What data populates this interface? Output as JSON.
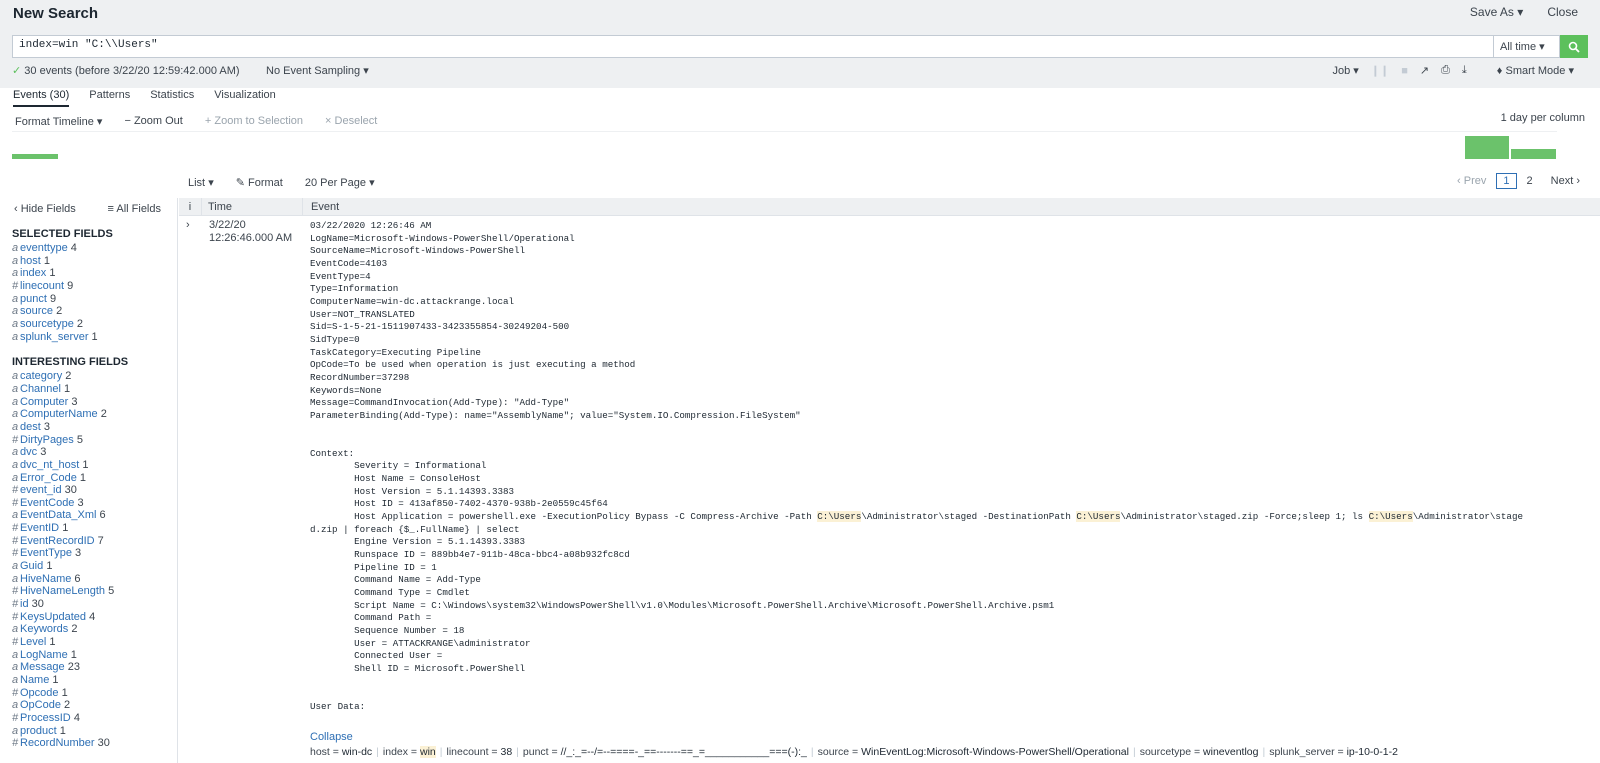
{
  "header": {
    "title": "New Search",
    "save_as": "Save As",
    "close": "Close"
  },
  "search": {
    "query": "index=win \"C:\\\\Users\"",
    "time_range": "All time"
  },
  "status": {
    "summary": "30 events (before 3/22/20 12:59:42.000 AM)",
    "sampling": "No Event Sampling",
    "job": "Job",
    "mode": "Smart Mode"
  },
  "tabs": [
    "Events (30)",
    "Patterns",
    "Statistics",
    "Visualization"
  ],
  "timeline": {
    "format": "Format Timeline",
    "zoom_out": "Zoom Out",
    "zoom_selection": "Zoom to Selection",
    "deselect": "Deselect",
    "scale": "1 day per column",
    "bars": [
      {
        "level": 0.18
      },
      {
        "level": 0.82
      },
      {
        "level": 0.36
      }
    ]
  },
  "list_controls": {
    "list": "List",
    "format": "Format",
    "per_page": "20 Per Page"
  },
  "pager": {
    "prev": "Prev",
    "pages": [
      "1",
      "2"
    ],
    "next": "Next"
  },
  "sidebar": {
    "hide_fields": "Hide Fields",
    "all_fields": "All Fields",
    "selected_heading": "SELECTED FIELDS",
    "interesting_heading": "INTERESTING FIELDS",
    "selected": [
      {
        "type": "a",
        "name": "eventtype",
        "count": "4"
      },
      {
        "type": "a",
        "name": "host",
        "count": "1"
      },
      {
        "type": "a",
        "name": "index",
        "count": "1"
      },
      {
        "type": "#",
        "name": "linecount",
        "count": "9"
      },
      {
        "type": "a",
        "name": "punct",
        "count": "9"
      },
      {
        "type": "a",
        "name": "source",
        "count": "2"
      },
      {
        "type": "a",
        "name": "sourcetype",
        "count": "2"
      },
      {
        "type": "a",
        "name": "splunk_server",
        "count": "1"
      }
    ],
    "interesting": [
      {
        "type": "a",
        "name": "category",
        "count": "2"
      },
      {
        "type": "a",
        "name": "Channel",
        "count": "1"
      },
      {
        "type": "a",
        "name": "Computer",
        "count": "3"
      },
      {
        "type": "a",
        "name": "ComputerName",
        "count": "2"
      },
      {
        "type": "a",
        "name": "dest",
        "count": "3"
      },
      {
        "type": "#",
        "name": "DirtyPages",
        "count": "5"
      },
      {
        "type": "a",
        "name": "dvc",
        "count": "3"
      },
      {
        "type": "a",
        "name": "dvc_nt_host",
        "count": "1"
      },
      {
        "type": "a",
        "name": "Error_Code",
        "count": "1"
      },
      {
        "type": "#",
        "name": "event_id",
        "count": "30"
      },
      {
        "type": "#",
        "name": "EventCode",
        "count": "3"
      },
      {
        "type": "a",
        "name": "EventData_Xml",
        "count": "6"
      },
      {
        "type": "#",
        "name": "EventID",
        "count": "1"
      },
      {
        "type": "#",
        "name": "EventRecordID",
        "count": "7"
      },
      {
        "type": "#",
        "name": "EventType",
        "count": "3"
      },
      {
        "type": "a",
        "name": "Guid",
        "count": "1"
      },
      {
        "type": "a",
        "name": "HiveName",
        "count": "6"
      },
      {
        "type": "#",
        "name": "HiveNameLength",
        "count": "5"
      },
      {
        "type": "#",
        "name": "id",
        "count": "30"
      },
      {
        "type": "#",
        "name": "KeysUpdated",
        "count": "4"
      },
      {
        "type": "a",
        "name": "Keywords",
        "count": "2"
      },
      {
        "type": "#",
        "name": "Level",
        "count": "1"
      },
      {
        "type": "a",
        "name": "LogName",
        "count": "1"
      },
      {
        "type": "a",
        "name": "Message",
        "count": "23"
      },
      {
        "type": "a",
        "name": "Name",
        "count": "1"
      },
      {
        "type": "#",
        "name": "Opcode",
        "count": "1"
      },
      {
        "type": "a",
        "name": "OpCode",
        "count": "2"
      },
      {
        "type": "#",
        "name": "ProcessID",
        "count": "4"
      },
      {
        "type": "a",
        "name": "product",
        "count": "1"
      },
      {
        "type": "#",
        "name": "RecordNumber",
        "count": "30"
      }
    ]
  },
  "table": {
    "col_info": "i",
    "col_time": "Time",
    "col_event": "Event"
  },
  "event": {
    "date": "3/22/20",
    "time": "12:26:46.000 AM",
    "lines": [
      "03/22/2020 12:26:46 AM",
      "LogName=Microsoft-Windows-PowerShell/Operational",
      "SourceName=Microsoft-Windows-PowerShell",
      "EventCode=4103",
      "EventType=4",
      "Type=Information",
      "ComputerName=win-dc.attackrange.local",
      "User=NOT_TRANSLATED",
      "Sid=S-1-5-21-1511907433-3423355854-30249204-500",
      "SidType=0",
      "TaskCategory=Executing Pipeline",
      "OpCode=To be used when operation is just executing a method",
      "RecordNumber=37298",
      "Keywords=None",
      "Message=CommandInvocation(Add-Type): \"Add-Type\"",
      "ParameterBinding(Add-Type): name=\"AssemblyName\"; value=\"System.IO.Compression.FileSystem\"",
      "",
      "",
      "Context:",
      "        Severity = Informational",
      "        Host Name = ConsoleHost",
      "        Host Version = 5.1.14393.3383",
      "        Host ID = 413af850-7402-4370-938b-2e0559c45f64"
    ],
    "app_line": {
      "p1": "        Host Application = powershell.exe -ExecutionPolicy Bypass -C Compress-Archive -Path ",
      "h1": "C:\\Users",
      "p2": "\\Administrator\\staged -DestinationPath ",
      "h2": "C:\\Users",
      "p3": "\\Administrator\\staged.zip -Force;sleep 1; ls ",
      "h3": "C:\\Users",
      "p4": "\\Administrator\\stage",
      "wrap": "d.zip | foreach {$_.FullName} | select"
    },
    "lines2": [
      "        Engine Version = 5.1.14393.3383",
      "        Runspace ID = 889bb4e7-911b-48ca-bbc4-a08b932fc8cd",
      "        Pipeline ID = 1",
      "        Command Name = Add-Type",
      "        Command Type = Cmdlet",
      "        Script Name = C:\\Windows\\system32\\WindowsPowerShell\\v1.0\\Modules\\Microsoft.PowerShell.Archive\\Microsoft.PowerShell.Archive.psm1",
      "        Command Path = ",
      "        Sequence Number = 18",
      "        User = ATTACKRANGE\\administrator",
      "        Connected User = ",
      "        Shell ID = Microsoft.PowerShell",
      "",
      "",
      "User Data:"
    ],
    "collapse": "Collapse",
    "meta": [
      {
        "key": "host = ",
        "value": "win-dc",
        "hl": false
      },
      {
        "key": "index = ",
        "value": "win",
        "hl": true
      },
      {
        "key": "linecount = ",
        "value": "38",
        "hl": false
      },
      {
        "key": "punct = ",
        "value": "//_:_=--/=--====-_==-------==_=___________===(-):_",
        "hl": false
      },
      {
        "key": "source = ",
        "value": "WinEventLog:Microsoft-Windows-PowerShell/Operational",
        "hl": false
      },
      {
        "key": "sourcetype = ",
        "value": "wineventlog",
        "hl": false
      },
      {
        "key": "splunk_server = ",
        "value": "ip-10-0-1-2",
        "hl": false
      }
    ]
  }
}
